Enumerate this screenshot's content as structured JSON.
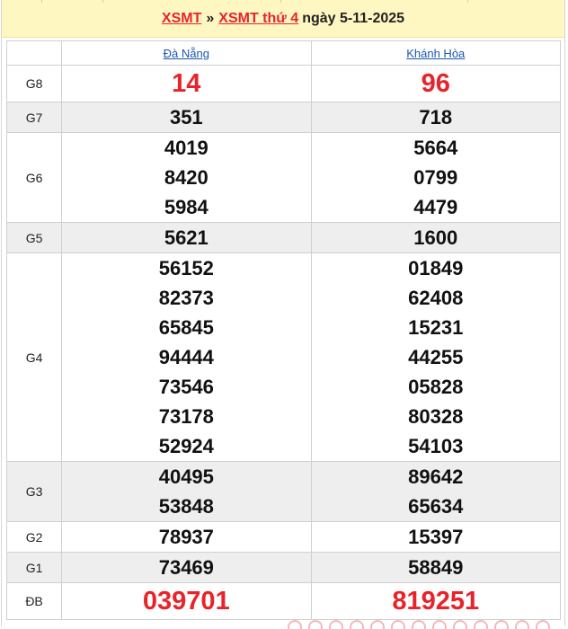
{
  "breadcrumb": {
    "link1": "XSMT",
    "separator": "»",
    "link2": "XSMT thứ 4",
    "date_text": "ngày 5-11-2025"
  },
  "table": {
    "provinces": [
      "Đà Nẵng",
      "Khánh Hòa"
    ],
    "rows": [
      {
        "label": "G8",
        "big": true,
        "values": [
          [
            "14"
          ],
          [
            "96"
          ]
        ]
      },
      {
        "label": "G7",
        "values": [
          [
            "351"
          ],
          [
            "718"
          ]
        ]
      },
      {
        "label": "G6",
        "values": [
          [
            "4019",
            "8420",
            "5984"
          ],
          [
            "5664",
            "0799",
            "4479"
          ]
        ]
      },
      {
        "label": "G5",
        "values": [
          [
            "5621"
          ],
          [
            "1600"
          ]
        ]
      },
      {
        "label": "G4",
        "values": [
          [
            "56152",
            "82373",
            "65845",
            "94444",
            "73546",
            "73178",
            "52924"
          ],
          [
            "01849",
            "62408",
            "15231",
            "44255",
            "05828",
            "80328",
            "54103"
          ]
        ]
      },
      {
        "label": "G3",
        "values": [
          [
            "40495",
            "53848"
          ],
          [
            "89642",
            "65634"
          ]
        ]
      },
      {
        "label": "G2",
        "values": [
          [
            "78937"
          ],
          [
            "15397"
          ]
        ]
      },
      {
        "label": "G1",
        "values": [
          [
            "73469"
          ],
          [
            "58849"
          ]
        ]
      },
      {
        "label": "ĐB",
        "big": true,
        "values": [
          [
            "039701"
          ],
          [
            "819251"
          ]
        ]
      }
    ]
  },
  "colors": {
    "header_bg": "#fff7c2",
    "accent_red": "#e8232a",
    "link_blue": "#1a56b0",
    "row_shade": "#eeeeee"
  }
}
